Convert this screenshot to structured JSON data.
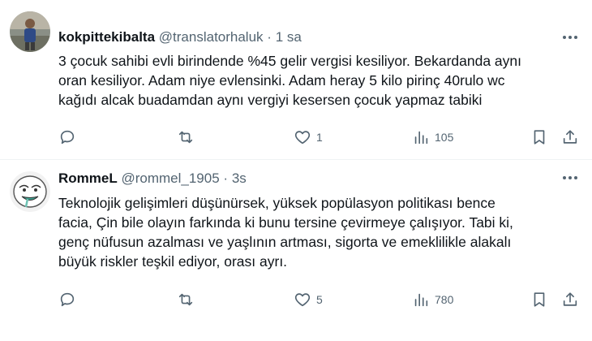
{
  "tweets": [
    {
      "name": "kokpittekibalta",
      "handle": "@translatorhaluk",
      "separator": "·",
      "time": "1 sa",
      "text_lines": [
        "3 çocuk sahibi evli birindende %45 gelir vergisi kesiliyor. Bekardanda aynı",
        "oran kesiliyor. Adam niye evlensinki. Adam heray 5 kilo pirinç 40rulo wc",
        "kağıdı alcak buadamdan aynı vergiyi kesersen çocuk yapmaz tabiki"
      ],
      "likes": "1",
      "views": "105"
    },
    {
      "name": "RommeL",
      "handle": "@rommel_1905",
      "separator": "·",
      "time": "3s",
      "text_lines": [
        "Teknolojik gelişimleri düşünürsek, yüksek popülasyon politikası bence",
        "facia, Çin bile olayın farkında ki bunu tersine çevirmeye çalışıyor. Tabi ki,",
        "genç nüfusun azalması ve yaşlının artması, sigorta ve emeklilikle alakalı",
        "büyük riskler teşkil ediyor, orası ayrı."
      ],
      "likes": "5",
      "views": "780"
    }
  ],
  "icons": {
    "reply": "reply-icon",
    "retweet": "retweet-icon",
    "like": "heart-icon",
    "views": "views-icon",
    "bookmark": "bookmark-icon",
    "share": "share-icon",
    "more": "more-icon"
  },
  "colors": {
    "text": "#0f1419",
    "secondary": "#536471",
    "divider": "#eff3f4"
  }
}
